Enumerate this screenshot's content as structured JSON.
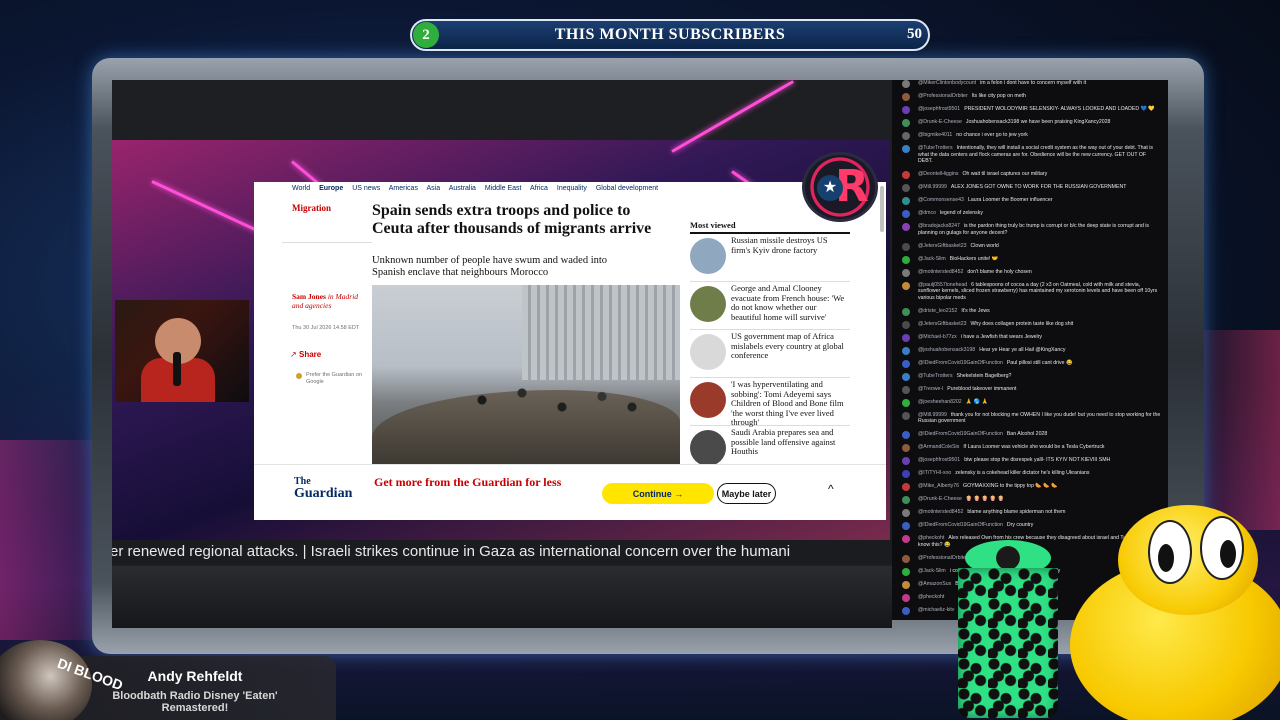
{
  "subscriber_bar": {
    "left_count": "2",
    "title": "THIS MONTH SUBSCRIBERS",
    "right_count": "50",
    "accent_color": "#2fae3c"
  },
  "article": {
    "nav": [
      "World",
      "Europe",
      "US news",
      "Americas",
      "Asia",
      "Australia",
      "Middle East",
      "Africa",
      "Inequality",
      "Global development"
    ],
    "nav_active": "Europe",
    "kicker": "Migration",
    "headline": "Spain sends extra troops and police to Ceuta after thousands of migrants arrive",
    "standfirst": "Unknown number of people have swum and waded into Spanish enclave that neighbours Morocco",
    "byline_name": "Sam Jones",
    "byline_rest": "in Madrid and agencies",
    "dateline": "Thu 30 Jul 2026 14.58 EDT",
    "share_label": "Share",
    "prefer_text": "Prefer the Guardian on Google",
    "most_viewed_title": "Most viewed",
    "most_viewed": [
      "Russian missile destroys US firm's Kyiv drone factory",
      "George and Amal Clooney evacuate from French house: 'We do not know whether our beautiful home will survive'",
      "US government map of Africa mislabels every country at global conference",
      "'I was hyperventilating and sobbing': Tomi Adeyemi says Children of Blood and Bone film 'the worst thing I've ever lived through'",
      "Saudi Arabia prepares sea and possible land offensive against Houthis"
    ]
  },
  "banner": {
    "logo_the": "The",
    "logo_main": "Guardian",
    "cta": "Get more from the Guardian for less",
    "continue_label": "Continue →",
    "later_label": "Maybe later",
    "collapse_icon": "^"
  },
  "ticker": {
    "text": "er renewed regional attacks. | Israeli strikes continue in Gaza as international concern over the humani"
  },
  "chat": [
    {
      "user": "@MikerClintonbodycount",
      "text": "im a felon i dont have to concern myself with it",
      "color": "#7a7a7a"
    },
    {
      "user": "@ProfessionalOrbiter",
      "text": "Its like city pop on meth",
      "color": "#8e5a3c"
    },
    {
      "user": "@josephfrost9501",
      "text": "PRESIDENT WOLODYMIR SELENSKIY- ALWAYS LOOKED AND LOADED 💙 💛",
      "color": "#6a3fb5"
    },
    {
      "user": "@Drunk-E-Cheese",
      "text": "Joshuahobensack3198 we have been praising KingXancy2028",
      "color": "#3f8f5a"
    },
    {
      "user": "@bigmike4011",
      "text": "no chance i ever go to jew york",
      "color": "#666"
    },
    {
      "user": "@TubeTrotters",
      "text": "Intentionally, they will install a social credit system as the way out of your debt. That is what the data centers and flock cameras are for. Obedience will be the new currency. GET OUT OF DEBT.",
      "color": "#3a7ec4"
    },
    {
      "user": "@DeontelHiggins",
      "text": "Oh wait til israel captures our military",
      "color": "#c43a3a"
    },
    {
      "user": "@Mill.99999",
      "text": "ALEX JONES GOT OWNE TO WORK FOR THE RUSSIAN GOVERNMENT",
      "color": "#555"
    },
    {
      "user": "@Commonsense43",
      "text": "Laura Loomer the Boomer influencer",
      "color": "#2f8f8f"
    },
    {
      "user": "@dmco",
      "text": "legend of zelensky",
      "color": "#3a5ec4"
    },
    {
      "user": "@bradojacks8247",
      "text": "is the pardon thing truly bc trump is corrupt or b/c the deep state is corrupt and is planning on gulags for anyone decent?",
      "color": "#8a3fb5"
    },
    {
      "user": "@JetersGiftbasket23",
      "text": "Clown world",
      "color": "#4a4a4a"
    },
    {
      "user": "@Jack-Slim",
      "text": "BioHackers unite! 🤝",
      "color": "#2fae3c"
    },
    {
      "user": "@motintersted8452",
      "text": "don't blame the holy chosen",
      "color": "#7a7a7a"
    },
    {
      "user": "@paulj0557lonehead",
      "text": "6 tablespoons of cocoa a day (2 x3 on Oatmeal, cold with milk and stevia, sunflower kernels, sliced frozen strawberry) has maintained my serotonin levels and have been off 10yrs various bipolar meds",
      "color": "#c48a3a"
    },
    {
      "user": "@driste_leo2152",
      "text": "It's the Jews",
      "color": "#3f8f5a"
    },
    {
      "user": "@JetersGiftbasket23",
      "text": "Why does collagen protein taste like dog shit",
      "color": "#4a4a4a"
    },
    {
      "user": "@Michael-b77zx",
      "text": "i have a Jewfish that wears Jewelry",
      "color": "#6a3fb5"
    },
    {
      "user": "@joshuahobensack3198",
      "text": "Hear ye Hear ye all Hail @KingXancy",
      "color": "#3a7ec4"
    },
    {
      "user": "@IDiedFromCovid19GainOfFunction",
      "text": "Paul pillosi still cant drive 😂",
      "color": "#3a5ec4"
    },
    {
      "user": "@TubeTrotters",
      "text": "Shekelstein Bagelberg?",
      "color": "#3a7ec4"
    },
    {
      "user": "@Treowe-l",
      "text": "Pureblood takeover immanent",
      "color": "#555"
    },
    {
      "user": "@joesheehan8202",
      "text": "🙏 🌎 🙏",
      "color": "#2fae3c"
    },
    {
      "user": "@Mill.99999",
      "text": "thank you for not blocking me OWHEN I like you dude! but you need to stop working for the Russian government",
      "color": "#555"
    },
    {
      "user": "@IDiedFromCovid19GainOfFunction",
      "text": "Ban Alcohol 2028",
      "color": "#3a5ec4"
    },
    {
      "user": "@ArmandColeSix",
      "text": "If Laura Loomer was vehicle she would be a Tesla Cybertruck",
      "color": "#8e5a3c"
    },
    {
      "user": "@josephfrost9501",
      "text": "btw please stop the disrespek yalll- ITS KYIV NOT KIEVIII SMH",
      "color": "#6a3fb5"
    },
    {
      "user": "@IT/TYHI-xoo",
      "text": "zelensky is a cokehead killer dictator he's killing Ukranians",
      "color": "#3a3fb5"
    },
    {
      "user": "@Mike_Alberty76",
      "text": "GOYMAXXING to the tippy top 🌭 🌭 🌭",
      "color": "#c43a3a"
    },
    {
      "user": "@Drunk-E-Cheese",
      "text": "🍿 🍿 🍿 🍿 🍿",
      "color": "#3f8f5a"
    },
    {
      "user": "@motintersted8452",
      "text": "blame anything blame spiderman not them",
      "color": "#7a7a7a"
    },
    {
      "user": "@IDiedFromCovid19GainOfFunction",
      "text": "Dry country",
      "color": "#3a5ec4"
    },
    {
      "user": "@pheckoht",
      "text": "Alex released Own from his crew because they disagreed about israel and Tucker do you not know this? 😂",
      "color": "#c43a8a"
    },
    {
      "user": "@ProfessionalOrbiter",
      "text": "🙏 🙏 🙏 🙏",
      "color": "#8e5a3c"
    },
    {
      "user": "@Jack-Slim",
      "text": "i could go for a half cheesecake from the bakery",
      "color": "#2fae3c"
    },
    {
      "user": "@AmazonSux",
      "text": "Brooklyn today",
      "color": "#c48a3a"
    },
    {
      "user": "@pheckoht",
      "text": "",
      "color": "#c43a8a"
    },
    {
      "user": "@michaeliz-kitv",
      "text": "",
      "color": "#3a5ec4"
    }
  ],
  "now_playing": {
    "artist": "Andy Rehfeldt",
    "title": "Bloodbath Radio Disney 'Eaten' Remastered!",
    "art_text": "DI BLOOD"
  }
}
